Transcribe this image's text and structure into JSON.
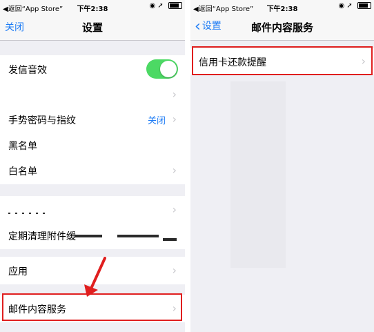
{
  "status_bar": {
    "back_label": "◀返回“App Store”",
    "time": "下午2:38",
    "right_icons": "◉ ➚"
  },
  "left_screen": {
    "nav": {
      "left_button": "关闭",
      "title": "设置"
    },
    "rows": {
      "sound": {
        "label": "发信音效",
        "toggle_on": true
      },
      "gesture": {
        "label": "手势密码与指纹",
        "value": "关闭"
      },
      "blacklist": {
        "label": "黑名单"
      },
      "whitelist": {
        "label": "白名单"
      },
      "cleanup": {
        "label": "定期清理附件缓"
      },
      "apps": {
        "label": "应用"
      },
      "mail_service": {
        "label": "邮件内容服务"
      }
    },
    "chevron": "›"
  },
  "right_screen": {
    "nav": {
      "back_chevron": "‹",
      "back_label": "设置",
      "title": "邮件内容服务"
    },
    "rows": {
      "credit_card": {
        "label": "信用卡还款提醒"
      }
    },
    "chevron": "›"
  },
  "colors": {
    "accent_blue": "#1e7cf5",
    "toggle_green": "#4cd964",
    "highlight_red": "#e01e1e",
    "group_background": "#efeff4"
  }
}
